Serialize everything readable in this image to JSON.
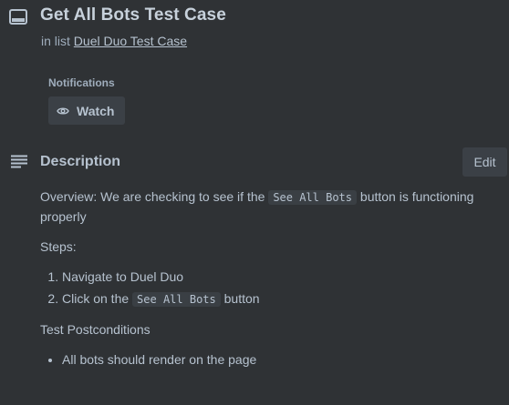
{
  "card": {
    "title": "Get All Bots Test Case",
    "list_prefix": "in list",
    "list_name": "Duel Duo Test Case"
  },
  "notifications": {
    "label": "Notifications",
    "watch_label": "Watch",
    "watch_icon": "eye-icon"
  },
  "description": {
    "title": "Description",
    "edit_label": "Edit",
    "overview_prefix": "Overview: We are checking to see if the",
    "overview_code": "See All Bots",
    "overview_suffix": "button is functioning properly",
    "steps_label": "Steps:",
    "step1": "Navigate to Duel Duo",
    "step2_prefix": "Click on the",
    "step2_code": "See All Bots",
    "step2_suffix": "button",
    "postconditions_label": "Test Postconditions",
    "postcondition1": "All bots should render on the page"
  },
  "icons": {
    "card": "card-icon",
    "description": "description-lines-icon"
  }
}
